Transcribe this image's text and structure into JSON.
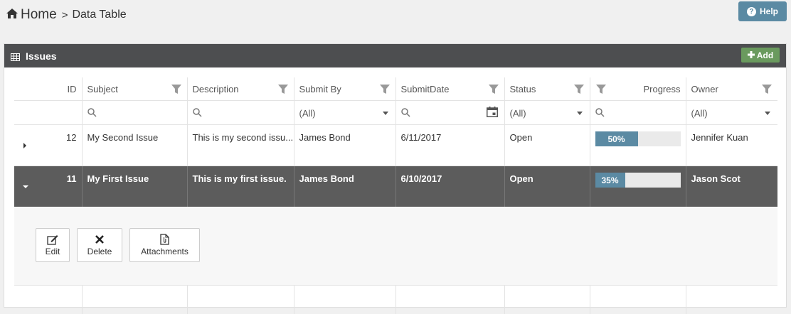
{
  "breadcrumb": {
    "home_label": "Home",
    "separator": ">",
    "current": "Data Table"
  },
  "help_label": "Help",
  "panel": {
    "title": "Issues",
    "add_label": "Add"
  },
  "columns": [
    {
      "key": "id",
      "label": "ID"
    },
    {
      "key": "subject",
      "label": "Subject"
    },
    {
      "key": "description",
      "label": "Description"
    },
    {
      "key": "submit_by",
      "label": "Submit By"
    },
    {
      "key": "submit_date",
      "label": "SubmitDate"
    },
    {
      "key": "status",
      "label": "Status"
    },
    {
      "key": "progress",
      "label": "Progress"
    },
    {
      "key": "owner",
      "label": "Owner"
    }
  ],
  "filters": {
    "submit_by": "(All)",
    "status": "(All)",
    "owner": "(All)"
  },
  "rows": [
    {
      "id": "12",
      "subject": "My Second Issue",
      "description": "This is my second issu...",
      "submit_by": "James Bond",
      "submit_date": "6/11/2017",
      "status": "Open",
      "progress": 50,
      "progress_label": "50%",
      "owner": "Jennifer Kuan",
      "expanded": false,
      "selected": false
    },
    {
      "id": "11",
      "subject": "My First Issue",
      "description": "This is my first issue.",
      "submit_by": "James Bond",
      "submit_date": "6/10/2017",
      "status": "Open",
      "progress": 35,
      "progress_label": "35%",
      "owner": "Jason Scot",
      "expanded": true,
      "selected": true
    }
  ],
  "detail_actions": {
    "edit": "Edit",
    "delete": "Delete",
    "attachments": "Attachments"
  },
  "icons": {
    "home": "home-icon",
    "help": "question-circle-icon",
    "grid": "table-grid-icon",
    "add": "plus-icon",
    "filter": "filter-funnel-icon",
    "search": "search-icon",
    "calendar": "calendar-icon",
    "edit": "edit-icon",
    "delete": "x-icon",
    "attachments": "attachment-file-icon"
  },
  "colors": {
    "header_bar": "#4d4e50",
    "help_button": "#5b8aa3",
    "add_button": "#6a9a5e",
    "selected_row": "#5c5c5c",
    "progress_fill": "#5b8aa3"
  }
}
